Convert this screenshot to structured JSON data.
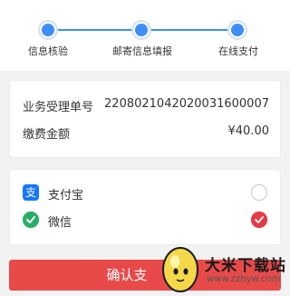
{
  "steps": [
    {
      "label": "信息核验"
    },
    {
      "label": "邮寄信息填报"
    },
    {
      "label": "在线支付"
    }
  ],
  "order": {
    "id_label": "业务受理单号",
    "id_value": "2208021042020031600007",
    "fee_label": "缴费金额",
    "fee_value": "¥40.00"
  },
  "payment": {
    "options": [
      {
        "label": "支付宝",
        "icon": "alipay-icon",
        "color": "#1677ff",
        "selected": false
      },
      {
        "label": "微信",
        "icon": "wechat-pay-icon",
        "color": "#2aae67",
        "selected": true
      }
    ]
  },
  "confirm_label": "确认支",
  "watermark": {
    "text": "大米下载站",
    "url": "www.zzhyw.com"
  },
  "colors": {
    "accent": "#3e8ef7",
    "confirm": "#e84a4a",
    "selected": "#e63a46"
  }
}
